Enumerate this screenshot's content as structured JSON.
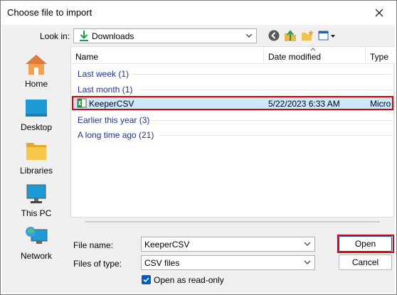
{
  "window": {
    "title": "Choose file to import"
  },
  "toolbar": {
    "look_in_label": "Look in:",
    "look_in_value": "Downloads"
  },
  "places": [
    {
      "label": "Home",
      "icon": "home-icon"
    },
    {
      "label": "Desktop",
      "icon": "desktop-icon"
    },
    {
      "label": "Libraries",
      "icon": "libraries-icon"
    },
    {
      "label": "This PC",
      "icon": "this-pc-icon"
    },
    {
      "label": "Network",
      "icon": "network-icon"
    }
  ],
  "file_list": {
    "columns": [
      "Name",
      "Date modified",
      "Type"
    ],
    "groups": [
      {
        "label": "Last week (1)"
      },
      {
        "label": "Last month (1)"
      },
      {
        "label": "Earlier this year (3)"
      },
      {
        "label": "A long time ago (21)"
      }
    ],
    "selected_file": {
      "name": "KeeperCSV",
      "date": "5/22/2023 6:33 AM",
      "type": "Micro"
    }
  },
  "form": {
    "file_name_label": "File name:",
    "file_name_value": "KeeperCSV",
    "files_of_type_label": "Files of type:",
    "files_of_type_value": "CSV files",
    "read_only_label": "Open as read-only",
    "read_only_checked": true
  },
  "buttons": {
    "open": "Open",
    "cancel": "Cancel"
  },
  "colors": {
    "accent": "#005fb8",
    "highlight": "#e00000",
    "selection": "#cce8ff",
    "group_text": "#1e3287"
  }
}
